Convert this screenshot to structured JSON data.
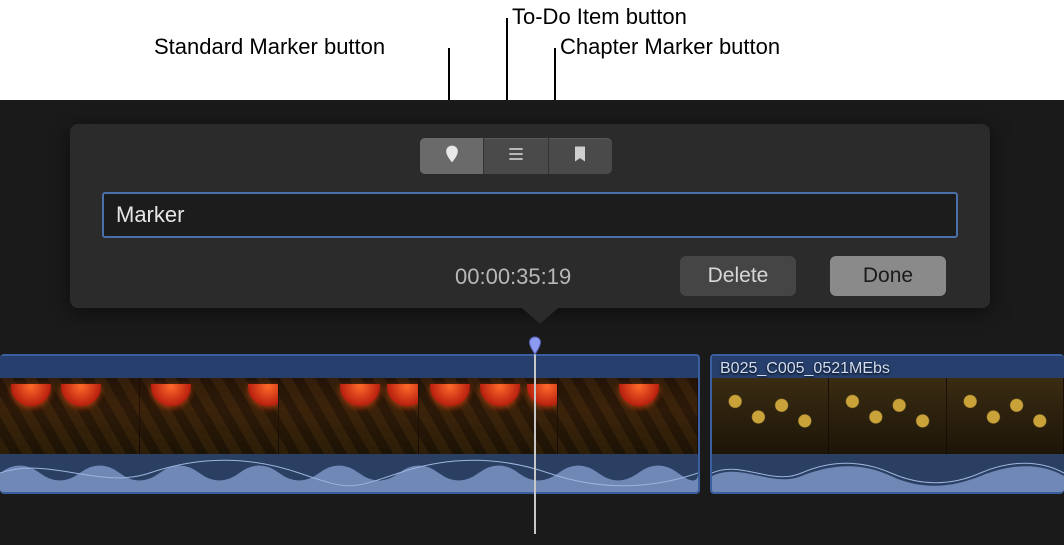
{
  "callouts": {
    "standard": "Standard Marker button",
    "todo": "To-Do Item button",
    "chapter": "Chapter Marker button"
  },
  "popover": {
    "marker_name_value": "Marker",
    "marker_name_placeholder": "Marker",
    "timecode": "00:00:35:19",
    "delete_label": "Delete",
    "done_label": "Done",
    "segments": {
      "standard_icon": "standard-marker-icon",
      "todo_icon": "todo-item-icon",
      "chapter_icon": "chapter-marker-icon",
      "active": "standard"
    }
  },
  "timeline": {
    "clip2_label": "B025_C005_0521MEbs"
  },
  "colors": {
    "accent_border": "#4b6fa8",
    "clip_border": "#3a5fa0",
    "marker_pin": "#7a8cf0"
  }
}
